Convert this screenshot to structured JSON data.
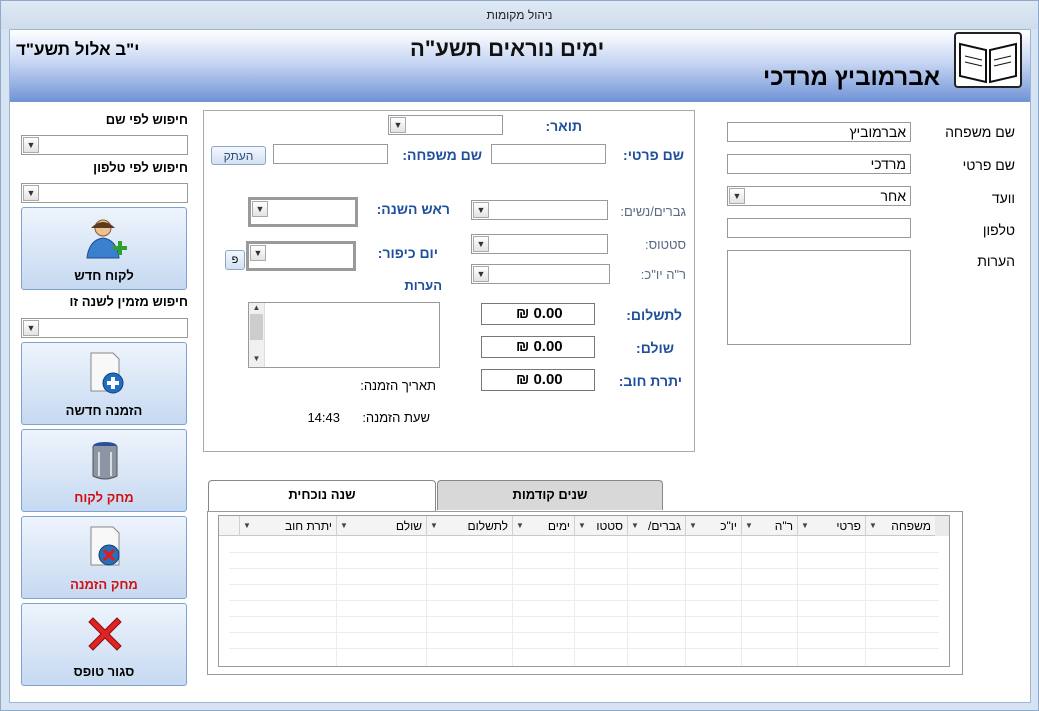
{
  "window": {
    "title": "ניהול מקומות"
  },
  "header": {
    "event_title": "ימים נוראים תשע\"ה",
    "date": "י\"ב אלול תשע\"ד",
    "customer_name": "אברמוביץ מרדכי"
  },
  "customer_form": {
    "last_name_label": "שם משפחה",
    "last_name_value": "אברמוביץ",
    "first_name_label": "שם פרטי",
    "first_name_value": "מרדכי",
    "committee_label": "וועד",
    "committee_value": "אחר",
    "phone_label": "טלפון",
    "phone_value": "",
    "notes_label": "הערות",
    "notes_value": ""
  },
  "order_form": {
    "title_label": "תואר:",
    "title_value": "",
    "first_name_label": "שם פרטי:",
    "first_name_value": "",
    "last_name_label": "שם משפחה:",
    "last_name_value": "",
    "copy_button": "העתק",
    "gender_label": "גברים/נשים:",
    "gender_value": "",
    "status_label": "סטטוס:",
    "status_value": "",
    "rh_yk_label": "ר\"ה יו\"כ:",
    "rh_yk_value": "",
    "rosh_hashana_label": "ראש השנה:",
    "rosh_hashana_value": "",
    "yom_kippur_label": "יום כיפור:",
    "yom_kippur_value": "",
    "p_button": "פ",
    "notes_label": "הערות",
    "to_pay_label": "לתשלום:",
    "to_pay_value": "0.00 ₪",
    "paid_label": "שולם:",
    "paid_value": "0.00 ₪",
    "balance_label": "יתרת חוב:",
    "balance_value": "0.00 ₪",
    "order_date_label": "תאריך הזמנה:",
    "order_date_value": "",
    "order_time_label": "שעת הזמנה:",
    "order_time_value": "14:43"
  },
  "sidebar": {
    "search_name_label": "חיפוש לפי שם",
    "search_phone_label": "חיפוש לפי טלפון",
    "search_orderer_label": "חיפוש מזמין לשנה זו",
    "buttons": {
      "new_customer": "לקוח חדש",
      "new_order": "הזמנה חדשה",
      "delete_customer": "מחק לקוח",
      "delete_order": "מחק הזמנה",
      "close_form": "סגור טופס"
    }
  },
  "tabs": {
    "current_year": "שנה נוכחית",
    "previous_years": "שנים קודמות"
  },
  "grid": {
    "columns": [
      "משפחה",
      "פרטי",
      "ר\"ה",
      "יו\"כ",
      "גברים/",
      "סטטו",
      "ימים",
      "לתשלום",
      "שולם",
      "יתרת חוב"
    ]
  },
  "colors": {
    "banner_dark": "#6f92d6",
    "label_blue": "#1f4e9a",
    "delete_red": "#d01010"
  },
  "icons": [
    "book-logo-icon",
    "user-add-icon",
    "document-add-icon",
    "trash-icon",
    "document-delete-icon",
    "close-x-icon"
  ]
}
